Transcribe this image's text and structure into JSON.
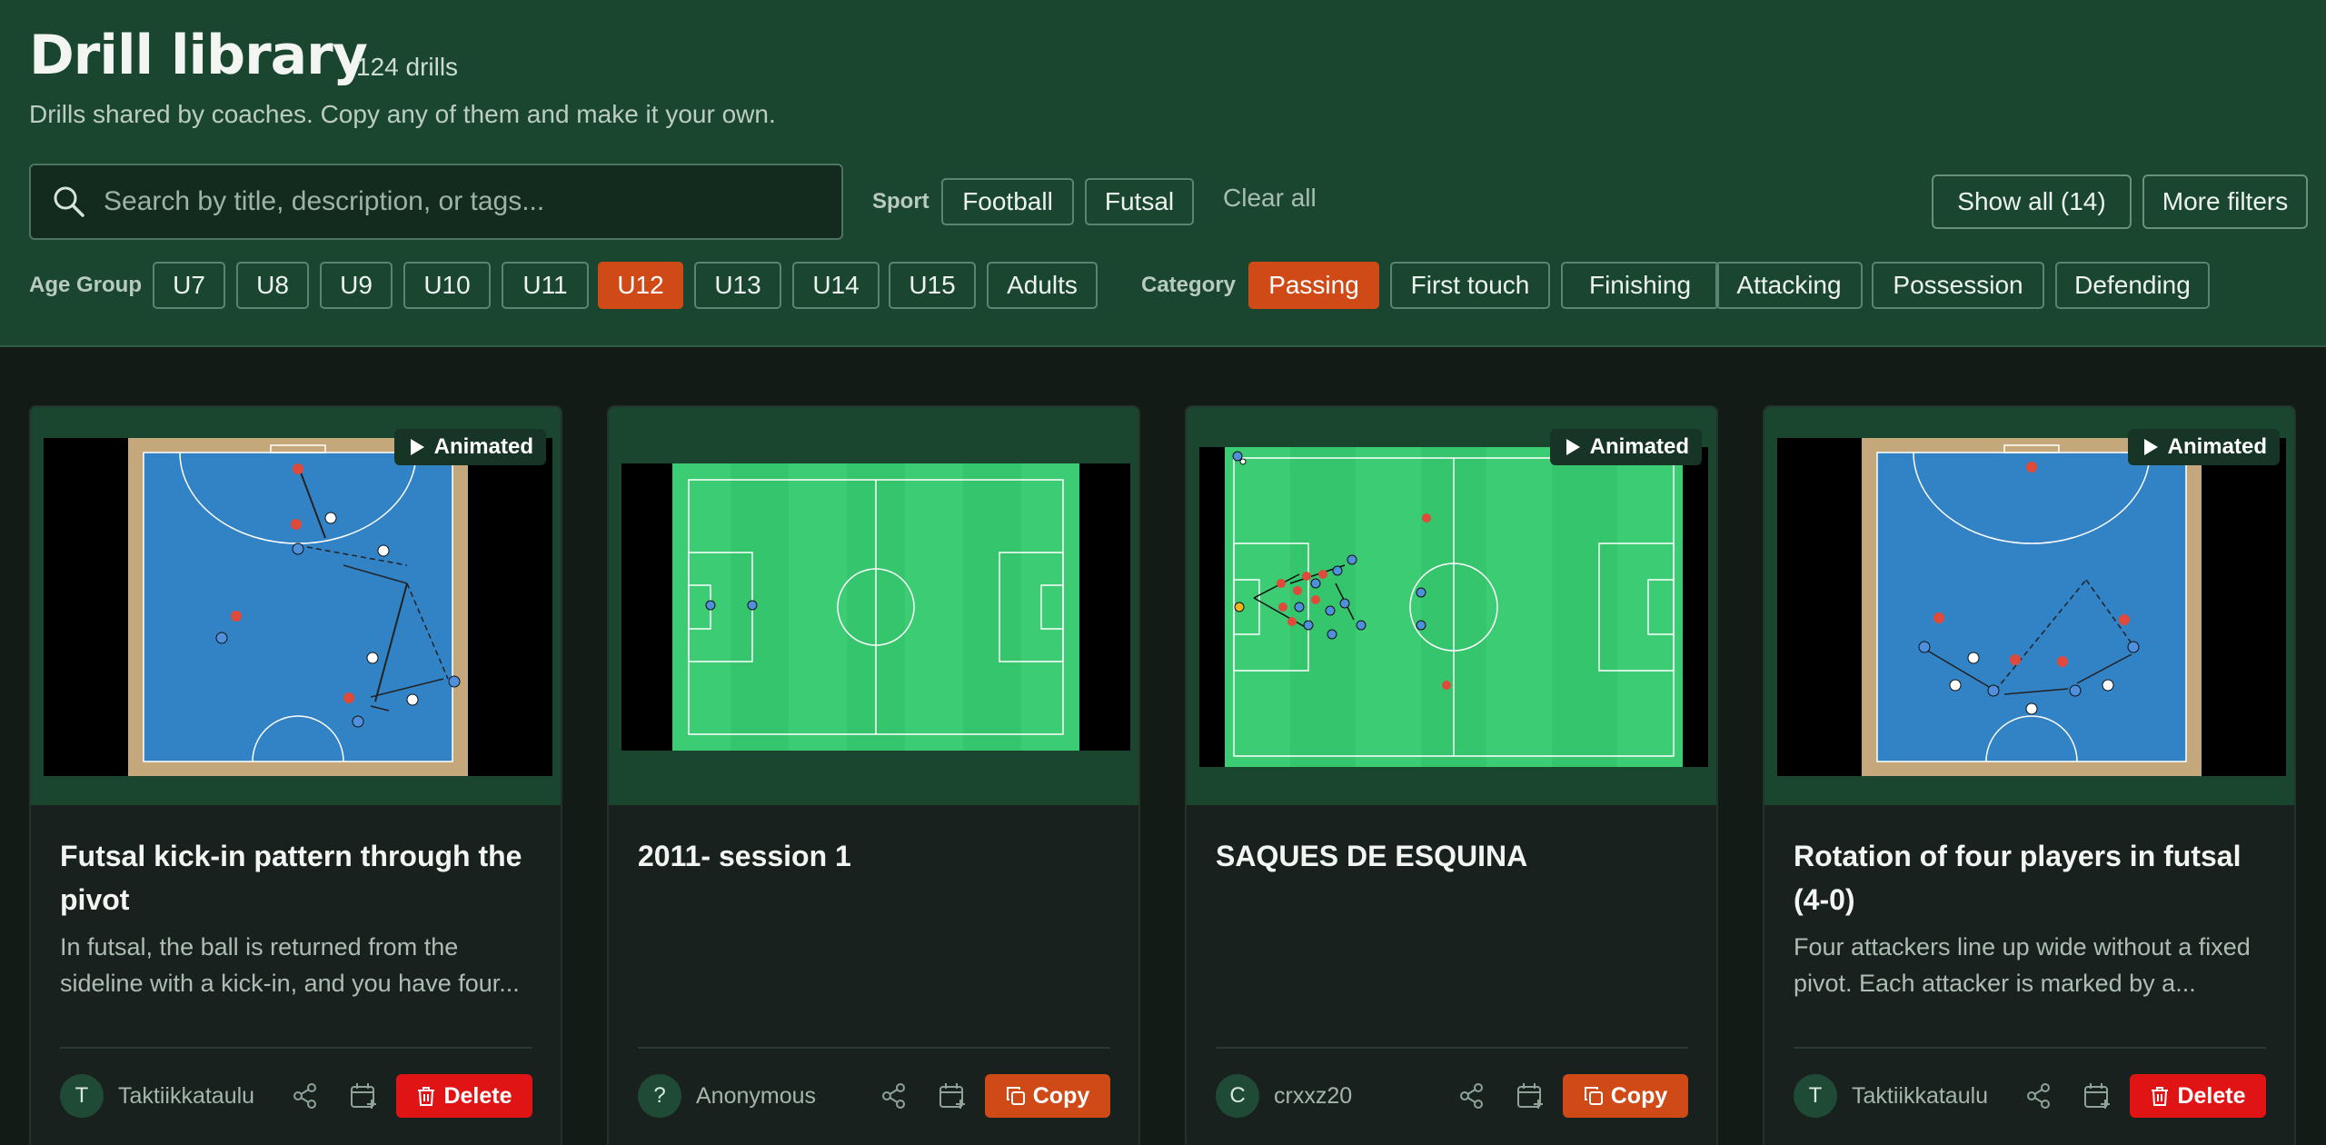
{
  "header": {
    "title": "Drill library",
    "count": "124 drills",
    "subtitle": "Drills shared by coaches. Copy any of them and make it your own."
  },
  "search": {
    "placeholder": "Search by title, description, or tags..."
  },
  "filters": {
    "sport_label": "Sport",
    "sports": [
      "Football",
      "Futsal"
    ],
    "clear_label": "Clear all",
    "show_all_label": "Show all (14)",
    "more_filters_label": "More filters",
    "age_label": "Age Group",
    "ages": [
      "U7",
      "U8",
      "U9",
      "U10",
      "U11",
      "U12",
      "U13",
      "U14",
      "U15",
      "Adults"
    ],
    "selected_age": "U12",
    "category_label": "Category",
    "categories": [
      "Passing",
      "First touch",
      "Finishing",
      "Attacking",
      "Possession",
      "Defending"
    ],
    "selected_category": "Passing"
  },
  "badge_label": "Animated",
  "cards": [
    {
      "title": "Futsal kick-in pattern through the pivot",
      "description": "In futsal, the ball is returned from the sideline with a kick-in, and you have four...",
      "avatar": "T",
      "author": "Taktiikkataulu",
      "action": "Delete",
      "animated": true,
      "pitch": "futsal"
    },
    {
      "title": "2011- session 1",
      "description": "",
      "avatar": "?",
      "author": "Anonymous",
      "action": "Copy",
      "animated": false,
      "pitch": "football"
    },
    {
      "title": "SAQUES DE ESQUINA",
      "description": "",
      "avatar": "C",
      "author": "crxxz20",
      "action": "Copy",
      "animated": true,
      "pitch": "football"
    },
    {
      "title": "Rotation of four players in futsal (4-0)",
      "description": "Four attackers line up wide without a fixed pivot. Each attacker is marked by a...",
      "avatar": "T",
      "author": "Taktiikkataulu",
      "action": "Delete",
      "animated": true,
      "pitch": "futsal"
    }
  ],
  "colors": {
    "header_bg": "#1a4630",
    "accent": "#cf4a17",
    "danger": "#e01414",
    "futsal_court": "#3282c6",
    "football_pitch": "#35c56c"
  }
}
